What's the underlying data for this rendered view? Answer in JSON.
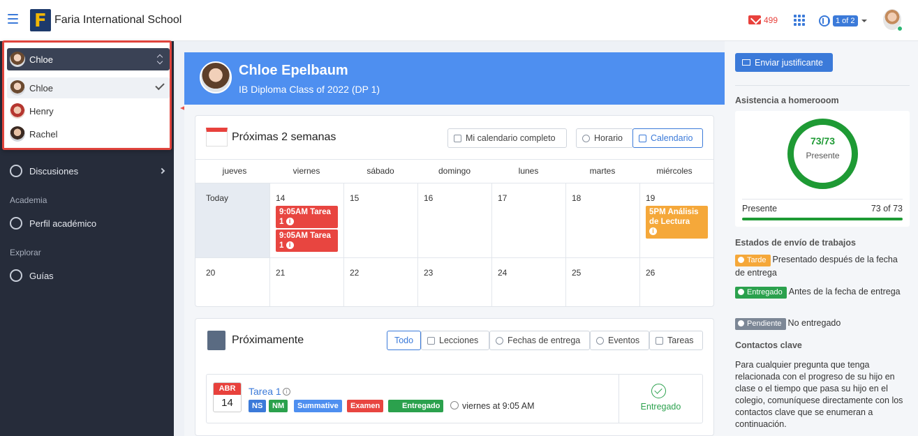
{
  "header": {
    "school_name": "Faria International School",
    "logo_letter": "F",
    "mail_count": "499",
    "family_badge": "1 of 2"
  },
  "child_selector": {
    "current": "Chloe",
    "options": [
      {
        "name": "Chloe",
        "selected": true
      },
      {
        "name": "Henry",
        "selected": false
      },
      {
        "name": "Rachel",
        "selected": false
      }
    ]
  },
  "sidebar": {
    "discussions": "Discusiones",
    "section_academia": "Academia",
    "perfil": "Perfil académico",
    "section_explorar": "Explorar",
    "guias": "Guías"
  },
  "student": {
    "name": "Chloe Epelbaum",
    "class": "IB Diploma Class of 2022 (DP 1)"
  },
  "calendar": {
    "title": "Próximas 2 semanas",
    "btn_full": "Mi calendario completo",
    "btn_schedule": "Horario",
    "btn_calendar": "Calendario",
    "days_of_week": [
      "jueves",
      "viernes",
      "sábado",
      "domingo",
      "lunes",
      "martes",
      "miércoles"
    ],
    "week1": [
      "Today",
      "14",
      "15",
      "16",
      "17",
      "18",
      "19"
    ],
    "week2": [
      "20",
      "21",
      "22",
      "23",
      "24",
      "25",
      "26"
    ],
    "events": [
      {
        "time": "9:05AM",
        "title": "Tarea",
        "suffix": "1"
      },
      {
        "time": "9:05AM",
        "title": "Tarea",
        "suffix": "1"
      },
      {
        "time": "5PM",
        "title": "Análisis",
        "suffix": "de Lectura"
      }
    ]
  },
  "upcoming": {
    "title": "Próximamente",
    "filters": [
      "Todo",
      "Lecciones",
      "Fechas de entrega",
      "Eventos",
      "Tareas"
    ],
    "task": {
      "month": "ABR",
      "day": "14",
      "title": "Tarea 1",
      "tags": [
        "NS",
        "NM",
        "Summative",
        "Examen",
        "Entregado"
      ],
      "time": "viernes at 9:05 AM",
      "status": "Entregado"
    }
  },
  "right": {
    "send_button": "Enviar justificante",
    "attendance_heading": "Asistencia a homerooom",
    "ring_value": "73/73",
    "ring_label": "Presente",
    "present_label": "Presente",
    "present_value": "73 of 73",
    "work_heading": "Estados de envío de trabajos",
    "legend": [
      {
        "tag": "Tarde",
        "text": "Presentado después de la fecha de entrega",
        "color": "#f5a83a"
      },
      {
        "tag": "Entregado",
        "text": "Antes de la fecha de entrega",
        "color": "#2ba14d"
      },
      {
        "tag": "Pendiente",
        "text": "No entregado",
        "color": "#7c8796"
      }
    ],
    "contacts_heading": "Contactos clave",
    "contacts_text": "Para cualquier pregunta que tenga relacionada con el progreso de su hijo en clase o el tiempo que pasa su hijo en el colegio, comuníquese directamente con los contactos clave que se enumeran a continuación."
  },
  "colors": {
    "accent": "#3b7ad9",
    "banner": "#4e8ff0",
    "alert": "#e8413c",
    "success": "#1e9a34",
    "sidebar": "#262c3a"
  }
}
